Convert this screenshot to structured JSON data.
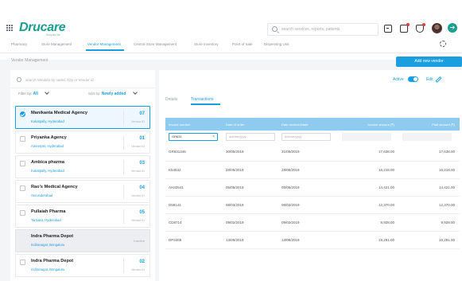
{
  "brand": {
    "logo": "Drucare",
    "tagline": "Simplify life"
  },
  "search": {
    "placeholder": "search services, reports, patients"
  },
  "tabs": [
    {
      "label": "Pharmacy",
      "active": false
    },
    {
      "label": "Store Management",
      "active": false
    },
    {
      "label": "Vendor Management",
      "active": true
    },
    {
      "label": "Central Store Management",
      "active": false
    },
    {
      "label": "Store Inventory",
      "active": false
    },
    {
      "label": "Point of Sale",
      "active": false
    },
    {
      "label": "Dispensing Unit",
      "active": false
    }
  ],
  "page": {
    "title": "Vendor Management",
    "add_button": "Add new vendor"
  },
  "vendor_list": {
    "search_placeholder": "search Vendors by name, City or Vendor id",
    "filter_label": "Filter by:",
    "filter_value": "All",
    "sort_label": "Sort by:",
    "sort_value": "Newly added",
    "items": [
      {
        "name": "Manikanta Medical Agency",
        "location": "Kukatpally, Hyderabad",
        "number": "07",
        "sub": "Vendor ID",
        "selected": true,
        "inactive": false
      },
      {
        "name": "Priyanka Agency",
        "location": "Ameerpet, Hyderabad",
        "number": "01",
        "sub": "Vendor ID",
        "selected": false,
        "inactive": false
      },
      {
        "name": "Ambica pharma",
        "location": "Kukatpally, Hyderabad",
        "number": "03",
        "sub": "Vendor ID",
        "selected": false,
        "inactive": false
      },
      {
        "name": "Rao's Medical Agency",
        "location": "Secunderabad",
        "number": "04",
        "sub": "Vendor ID",
        "selected": false,
        "inactive": false
      },
      {
        "name": "Pullaiah Pharma",
        "location": "Tarnaka, Hyderabad",
        "number": "05",
        "sub": "Vendor ID",
        "selected": false,
        "inactive": false
      },
      {
        "name": "Indra Pharma Depot",
        "location": "Indiranagar, Bengaluru",
        "number": "",
        "sub": "Inactive",
        "selected": false,
        "inactive": true
      },
      {
        "name": "Indra Pharma Depot",
        "location": "Indiranagar, Bengaluru",
        "number": "02",
        "sub": "Vendor ID",
        "selected": false,
        "inactive": false
      }
    ]
  },
  "detail": {
    "active_label": "Active",
    "active": true,
    "edit_label": "Edit",
    "tabs": [
      {
        "label": "Details",
        "active": false
      },
      {
        "label": "Transactions",
        "active": true
      }
    ],
    "table": {
      "headers": [
        "Invoice number",
        "Date of order",
        "Date received/date",
        "Invoice amount (₹)",
        "Paid amount (₹)"
      ],
      "filters": [
        "GR631",
        "dd/mm/yyyy",
        "dd/mm/yyyy",
        "",
        ""
      ],
      "rows": [
        [
          "GR631345",
          "30/05/2019",
          "31/05/2019",
          "17,638.00",
          "17,638.00"
        ],
        [
          "K54532",
          "28/05/2019",
          "28/05/2019",
          "16,218.00",
          "16,218.00"
        ],
        [
          "AH32541",
          "05/05/2019",
          "05/05/2019",
          "14,421.00",
          "14,421.00"
        ],
        [
          "D58141",
          "08/03/2019",
          "08/03/2019",
          "12,370.00",
          "12,370.00"
        ],
        [
          "CD8714",
          "09/02/2019",
          "09/02/2019",
          "9,928.00",
          "9,928.00"
        ],
        [
          "DP3465",
          "13/08/2019",
          "13/08/2019",
          "19,291.00",
          "19,291.00"
        ]
      ]
    }
  }
}
